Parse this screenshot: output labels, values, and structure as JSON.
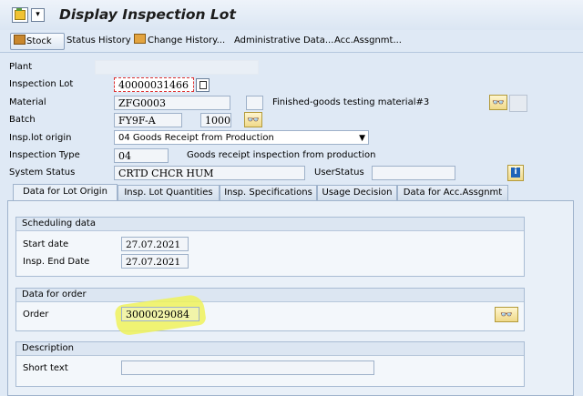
{
  "header": {
    "title": "Display Inspection Lot"
  },
  "toolbar": {
    "stock": "Stock",
    "status_history": "Status History",
    "change_history": "Change History...",
    "admin_data": "Administrative Data...",
    "acc_assgnmt": "Acc.Assgnmt..."
  },
  "form": {
    "plant_label": "Plant",
    "inspection_lot_label": "Inspection Lot",
    "inspection_lot_value": "40000031466",
    "material_label": "Material",
    "material_value": "ZFG0003",
    "material_desc": "Finished-goods testing material#3",
    "batch_label": "Batch",
    "batch_value": "FY9F-A",
    "batch_qty": "1000",
    "origin_label": "Insp.lot origin",
    "origin_value": "04 Goods Receipt from Production",
    "insp_type_label": "Inspection Type",
    "insp_type_value": "04",
    "insp_type_desc": "Goods receipt inspection from production",
    "system_status_label": "System Status",
    "system_status_value": "CRTD CHCR HUM",
    "user_status_label": "UserStatus"
  },
  "tabs": [
    {
      "label": "Data for Lot Origin"
    },
    {
      "label": "Insp. Lot Quantities"
    },
    {
      "label": "Insp. Specifications"
    },
    {
      "label": "Usage Decision"
    },
    {
      "label": "Data for Acc.Assgnmt"
    }
  ],
  "scheduling": {
    "title": "Scheduling data",
    "start_label": "Start date",
    "start_value": "27.07.2021",
    "end_label": "Insp. End Date",
    "end_value": "27.07.2021"
  },
  "order": {
    "title": "Data for order",
    "label": "Order",
    "value": "3000029084"
  },
  "description": {
    "title": "Description",
    "short_text_label": "Short text",
    "short_text_value": ""
  },
  "colors": {
    "highlight": "#eef25a",
    "accent": "#1c1c1c"
  }
}
